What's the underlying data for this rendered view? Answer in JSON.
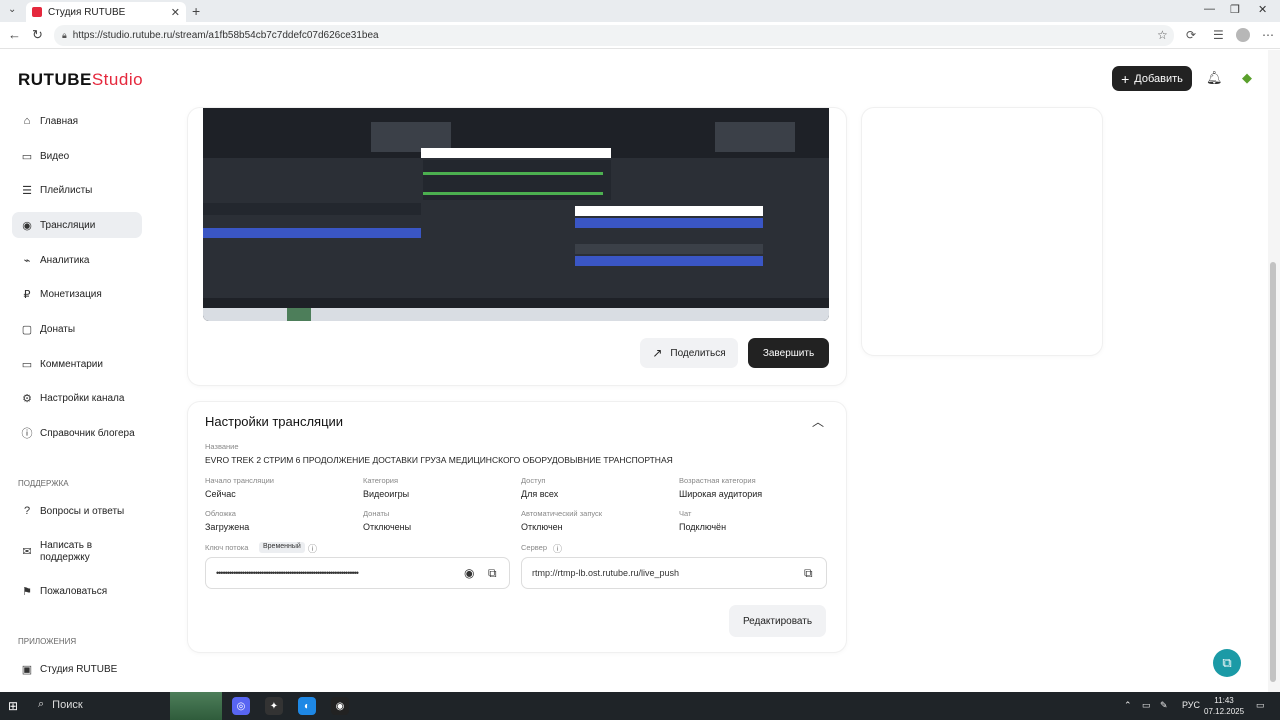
{
  "browser": {
    "tab_title": "Студия RUTUBE",
    "url": "https://studio.rutube.ru/stream/a1fb58b54cb7c7ddefc07d626ce31bea"
  },
  "header": {
    "logo_main": "RUTUBE",
    "logo_sub": "Studio",
    "add_label": "Добавить"
  },
  "sidebar": {
    "items": [
      {
        "label": "Главная",
        "icon": "home-icon"
      },
      {
        "label": "Видео",
        "icon": "video-icon"
      },
      {
        "label": "Плейлисты",
        "icon": "playlist-icon"
      },
      {
        "label": "Трансляции",
        "icon": "broadcast-icon"
      },
      {
        "label": "Аналитика",
        "icon": "analytics-icon"
      },
      {
        "label": "Монетизация",
        "icon": "money-icon"
      },
      {
        "label": "Донаты",
        "icon": "donate-icon"
      },
      {
        "label": "Комментарии",
        "icon": "comment-icon"
      },
      {
        "label": "Настройки канала",
        "icon": "settings-icon"
      },
      {
        "label": "Справочник блогера",
        "icon": "info-icon"
      }
    ],
    "support_title": "ПОДДЕРЖКА",
    "support_items": [
      {
        "label": "Вопросы и ответы",
        "icon": "help-icon"
      },
      {
        "label": "Написать в поддержку",
        "icon": "mail-icon"
      },
      {
        "label": "Пожаловаться",
        "icon": "flag-icon"
      }
    ],
    "apps_title": "ПРИЛОЖЕНИЯ",
    "apps_items": [
      {
        "label": "Студия RUTUBE",
        "icon": "studio-app-icon"
      }
    ]
  },
  "stream": {
    "share_label": "Поделиться",
    "finish_label": "Завершить"
  },
  "settings": {
    "title": "Настройки трансляции",
    "name_label": "Название",
    "name_value": "EVRO TREK 2 СТРИМ 6 ПРОДОЛЖЕНИЕ ДОСТАВКИ ГРУЗА МЕДИЦИНСКОГО ОБОРУДОВЫВНИЕ ТРАНСПОРТНАЯ",
    "fields": [
      {
        "label": "Начало трансляции",
        "value": "Сейчас"
      },
      {
        "label": "Категория",
        "value": "Видеоигры"
      },
      {
        "label": "Доступ",
        "value": "Для всех"
      },
      {
        "label": "Возрастная категория",
        "value": "Широкая аудитория"
      },
      {
        "label": "Обложка",
        "value": "Загружена"
      },
      {
        "label": "Донаты",
        "value": "Отключены"
      },
      {
        "label": "Автоматический запуск",
        "value": "Отключен"
      },
      {
        "label": "Чат",
        "value": "Подключён"
      }
    ],
    "key_label": "Ключ потока",
    "key_badge": "Временный",
    "key_value": "••••••••••••••••••••••••••••••••••••••••••••••••••••••••••••••••••",
    "server_label": "Сервер",
    "server_value": "rtmp://rtmp-lb.ost.rutube.ru/live_push",
    "edit_label": "Редактировать"
  },
  "taskbar": {
    "search_label": "Поиск",
    "lang": "РУС",
    "time": "11:43",
    "date": "07.12.2025"
  }
}
